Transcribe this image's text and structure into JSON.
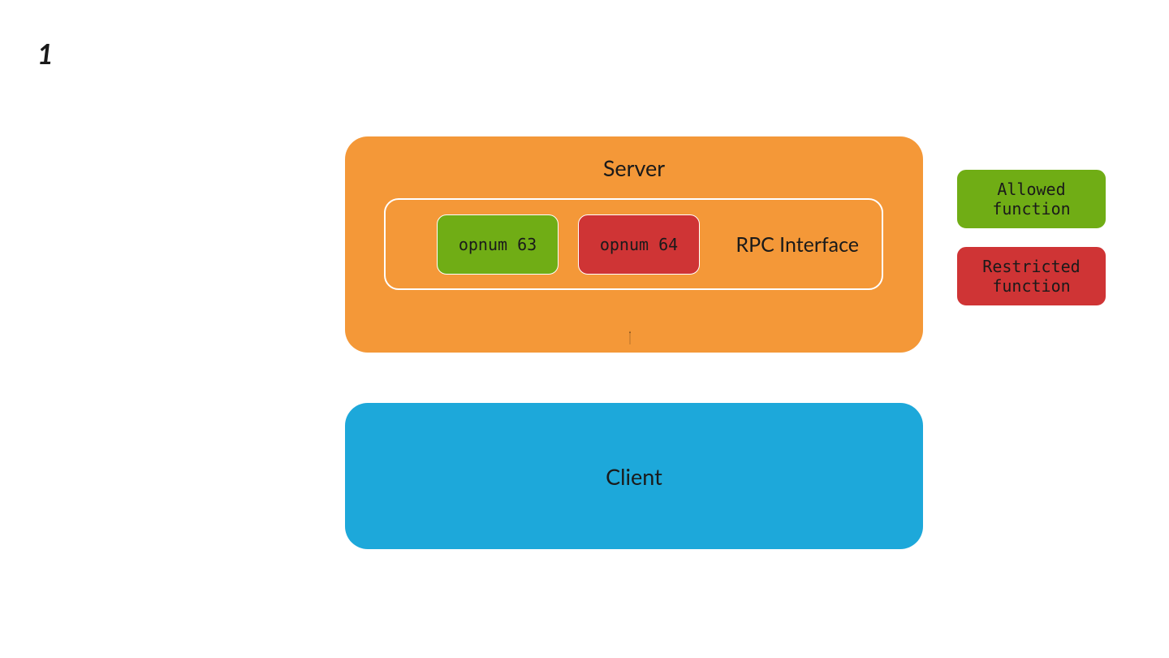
{
  "slide_number": "1",
  "server": {
    "title": "Server"
  },
  "rpc_interface": {
    "label": "RPC Interface"
  },
  "opnums": [
    {
      "label": "opnum 63",
      "kind": "allowed"
    },
    {
      "label": "opnum 64",
      "kind": "restricted"
    }
  ],
  "client": {
    "title": "Client"
  },
  "legend": {
    "allowed": "Allowed\nfunction",
    "restricted": "Restricted\nfunction"
  },
  "arrow": {
    "from": "client",
    "to": "opnum 64"
  },
  "colors": {
    "server": "#f49838",
    "client": "#1da8da",
    "allowed": "#70ad15",
    "restricted": "#cf3435",
    "outline": "#ffffff"
  }
}
